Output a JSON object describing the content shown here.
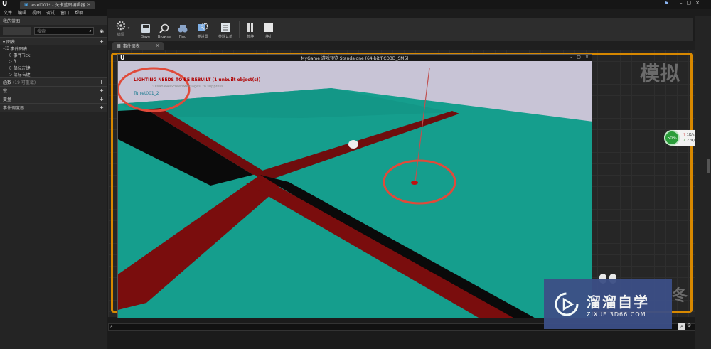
{
  "window": {
    "doc_tab": "level001* - 关卡蓝图编辑器",
    "menu": [
      "文件",
      "编辑",
      "视图",
      "调试",
      "窗口",
      "帮助"
    ]
  },
  "left_panel": {
    "tab": "我的蓝图",
    "search_placeholder": "搜索",
    "graph_section": "图表",
    "event_graph": "事件图表",
    "events": [
      "事件Tick",
      "R",
      "鼠标左键",
      "鼠标右键"
    ],
    "functions": "函数",
    "functions_note": "(19 可重载)",
    "macros": "宏",
    "variables": "变量",
    "event_dispatchers": "事件调度器"
  },
  "toolbar": {
    "buttons": [
      "编译",
      "Save",
      "Browse",
      "Find",
      "类设置",
      "类默认值",
      "暂停",
      "停止"
    ]
  },
  "graph": {
    "tab": "事件图表",
    "watermark_right": "模拟",
    "corner_text": "冬"
  },
  "game_window": {
    "title": "MyGame 游戏预览 Standalone (64-bit/PCD3D_SM5)",
    "warning": "LIGHTING NEEDS TO BE REBUILT (1 unbuilt object(s))",
    "suppress": "'DisableAllScreenMessages' to suppress",
    "actor": "Turret001_2"
  },
  "net_widget": {
    "percent": "50%",
    "up": "1K/s",
    "down": "27K/s"
  },
  "watermark": {
    "title": "溜溜自学",
    "url": "ZIXUE.3D66.COM"
  },
  "colors": {
    "accent_orange": "#d78800",
    "floor_teal": "#159e8d",
    "trench_red": "#7a0d0d",
    "annotation_red": "#e04a3a"
  }
}
